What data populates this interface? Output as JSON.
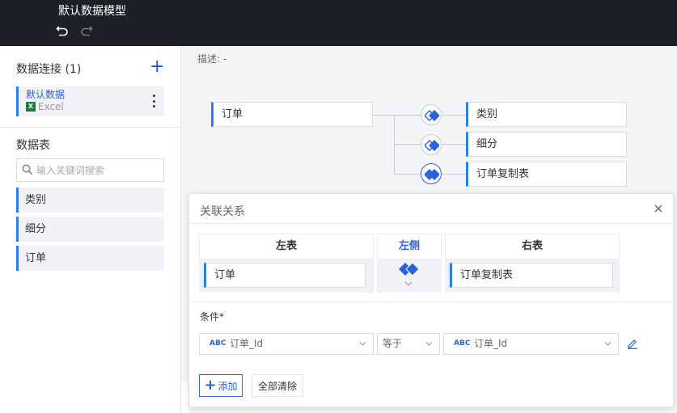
{
  "topbar": {
    "title": "默认数据模型"
  },
  "sidebar": {
    "connections_heading": "数据连接 (1)",
    "connection": {
      "name": "默认数据",
      "type": "Excel",
      "type_icon": "excel-icon"
    },
    "tables_heading": "数据表",
    "search_placeholder": "输入关键词搜索",
    "tables": [
      {
        "label": "类别"
      },
      {
        "label": "细分"
      },
      {
        "label": "订单"
      }
    ]
  },
  "canvas": {
    "description": "描述: -",
    "root_node": "订单",
    "child_nodes": [
      {
        "label": "类别"
      },
      {
        "label": "细分"
      },
      {
        "label": "订单复制表"
      }
    ]
  },
  "relation_panel": {
    "title": "关联关系",
    "left_header": "左表",
    "join_header": "左侧",
    "right_header": "右表",
    "left_table": "订单",
    "right_table": "订单复制表",
    "condition_label": "条件*",
    "conditions": [
      {
        "left_type": "ABC",
        "left_field": "订单_Id",
        "operator": "等于",
        "right_type": "ABC",
        "right_field": "订单_Id"
      }
    ],
    "add_label": "添加",
    "clear_label": "全部清除"
  },
  "colors": {
    "accent": "#2a62d9",
    "topbar": "#1d2027",
    "node_border": "#2a7ee6"
  }
}
